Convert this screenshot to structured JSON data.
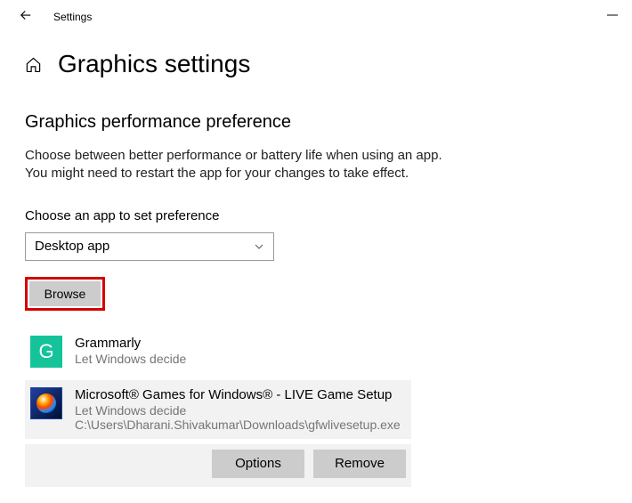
{
  "window": {
    "title": "Settings"
  },
  "page": {
    "title": "Graphics settings",
    "section_title": "Graphics performance preference",
    "description_line1": "Choose between better performance or battery life when using an app.",
    "description_line2": "You might need to restart the app for your changes to take effect.",
    "choose_label": "Choose an app to set preference"
  },
  "dropdown": {
    "selected": "Desktop app"
  },
  "browse": {
    "label": "Browse"
  },
  "apps": [
    {
      "name": "Grammarly",
      "preference": "Let Windows decide",
      "icon_text": "G"
    },
    {
      "name": "Microsoft® Games for Windows®  - LIVE Game Setup",
      "preference": "Let Windows decide",
      "path": "C:\\Users\\Dharani.Shivakumar\\Downloads\\gfwlivesetup.exe"
    }
  ],
  "actions": {
    "options": "Options",
    "remove": "Remove"
  }
}
